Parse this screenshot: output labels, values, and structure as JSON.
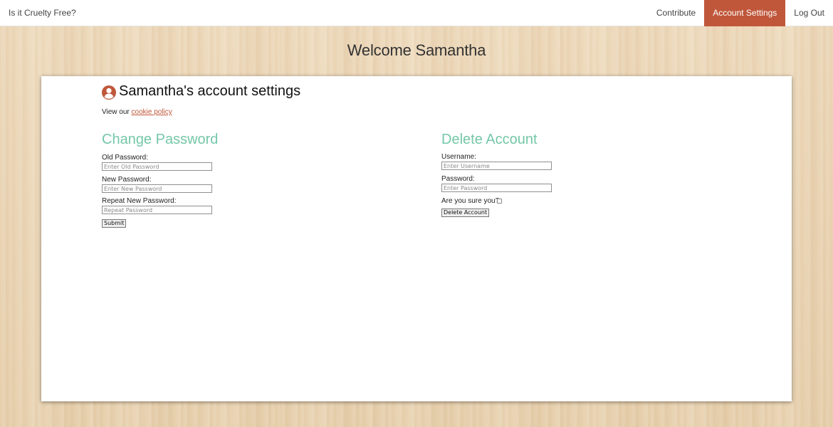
{
  "nav": {
    "brand": "Is it Cruelty Free?",
    "links": [
      {
        "label": "Contribute",
        "active": false
      },
      {
        "label": "Account Settings",
        "active": true
      },
      {
        "label": "Log Out",
        "active": false
      }
    ]
  },
  "colors": {
    "accent": "#c0573a",
    "heading_green": "#74c7a9"
  },
  "welcome": "Welcome Samantha",
  "account": {
    "icon": "user-circle-icon",
    "title": "Samantha's account settings",
    "cookie_prefix": "View our",
    "cookie_link": "cookie policy"
  },
  "change_password": {
    "heading": "Change Password",
    "old_label": "Old Password:",
    "old_placeholder": "Enter Old Password",
    "new_label": "New Password:",
    "new_placeholder": "Enter New Password",
    "repeat_label": "Repeat New Password:",
    "repeat_placeholder": "Repeat Password",
    "submit_label": "Submit"
  },
  "delete_account": {
    "heading": "Delete Account",
    "username_label": "Username:",
    "username_placeholder": "Enter Username",
    "password_label": "Password:",
    "password_placeholder": "Enter Password",
    "confirm_label": "Are you sure you?",
    "button_label": "Delete Account"
  }
}
